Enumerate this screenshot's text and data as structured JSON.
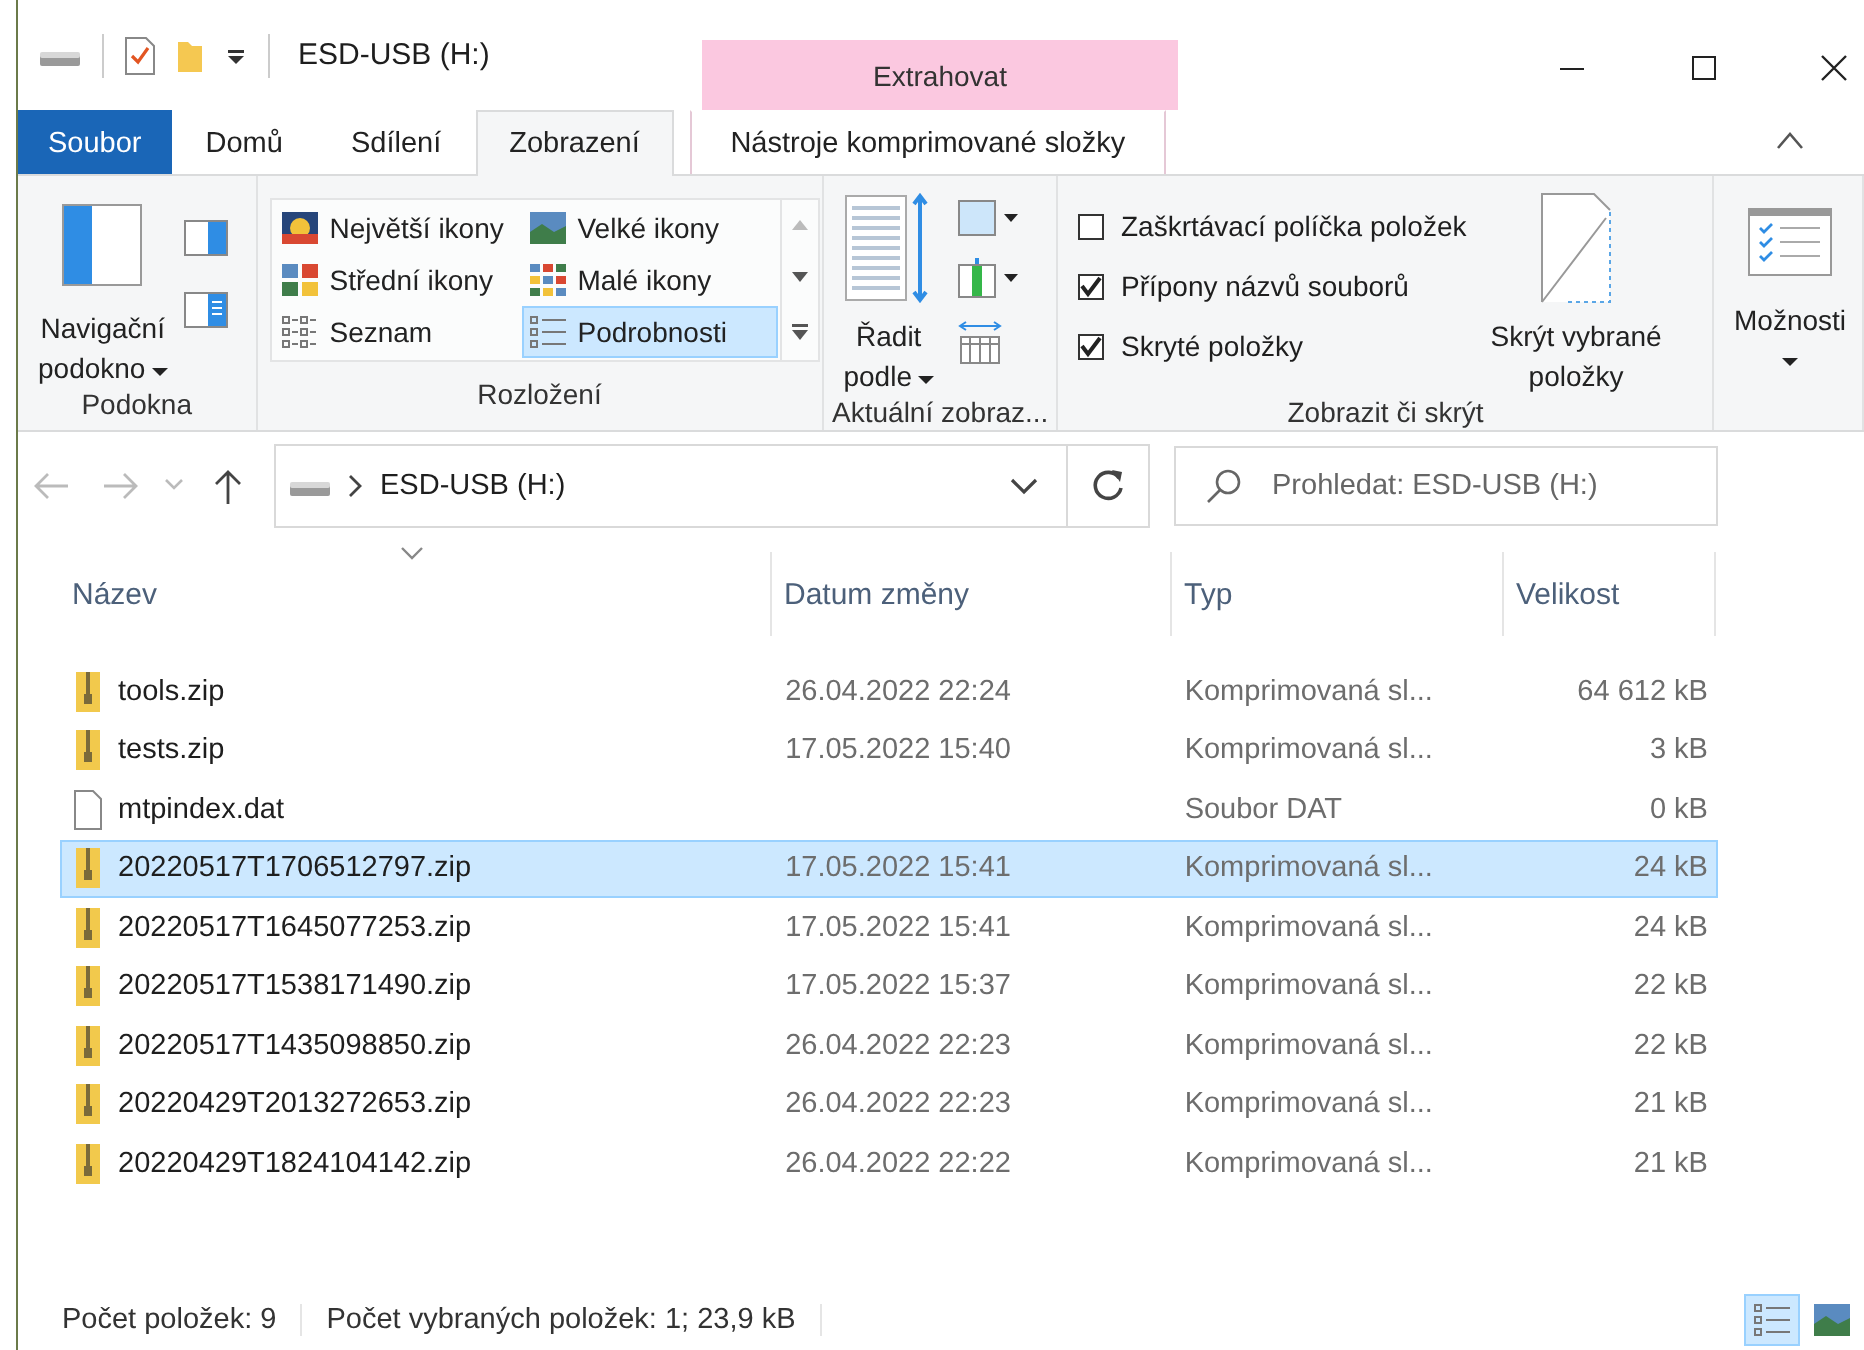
{
  "window": {
    "title": "ESD-USB (H:)",
    "context_group": "Extrahovat"
  },
  "tabs": [
    {
      "label": "Soubor",
      "kind": "file",
      "selected": false
    },
    {
      "label": "Domů",
      "kind": "normal",
      "selected": false
    },
    {
      "label": "Sdílení",
      "kind": "normal",
      "selected": false
    },
    {
      "label": "Zobrazení",
      "kind": "normal",
      "selected": true
    },
    {
      "label": "Nástroje komprimované složky",
      "kind": "context",
      "selected": false
    }
  ],
  "ribbon": {
    "panes": {
      "label": "Podokna",
      "nav_button": "Navigační\npodokno"
    },
    "layout": {
      "label": "Rozložení",
      "items": [
        {
          "label": "Největší ikony",
          "kind": "xl",
          "selected": false
        },
        {
          "label": "Velké ikony",
          "kind": "large",
          "selected": false
        },
        {
          "label": "Střední ikony",
          "kind": "medium",
          "selected": false
        },
        {
          "label": "Malé ikony",
          "kind": "small",
          "selected": false
        },
        {
          "label": "Seznam",
          "kind": "list",
          "selected": false
        },
        {
          "label": "Podrobnosti",
          "kind": "details",
          "selected": true
        }
      ]
    },
    "current_view": {
      "label": "Aktuální zobraz...",
      "sort_button": "Řadit\npodle"
    },
    "show_hide": {
      "label": "Zobrazit či skrýt",
      "checkboxes": [
        {
          "label": "Zaškrtávací políčka položek",
          "checked": false
        },
        {
          "label": "Přípony názvů souborů",
          "checked": true
        },
        {
          "label": "Skryté položky",
          "checked": true
        }
      ],
      "hide_button": "Skrýt vybrané\npoložky"
    },
    "options": {
      "button": "Možnosti"
    }
  },
  "address": {
    "path": "ESD-USB (H:)"
  },
  "search": {
    "placeholder": "Prohledat: ESD-USB (H:)"
  },
  "columns": [
    "Název",
    "Datum změny",
    "Typ",
    "Velikost"
  ],
  "rows": [
    {
      "kind": "zip",
      "name": "tools.zip",
      "date": "26.04.2022 22:24",
      "type": "Komprimovaná sl...",
      "size": "64 612 kB",
      "selected": false
    },
    {
      "kind": "zip",
      "name": "tests.zip",
      "date": "17.05.2022 15:40",
      "type": "Komprimovaná sl...",
      "size": "3 kB",
      "selected": false
    },
    {
      "kind": "file",
      "name": "mtpindex.dat",
      "type": "Soubor DAT",
      "size": "0 kB",
      "selected": false
    },
    {
      "kind": "zip",
      "name": "20220517T1706512797.zip",
      "date": "17.05.2022 15:41",
      "type": "Komprimovaná sl...",
      "size": "24 kB",
      "selected": true
    },
    {
      "kind": "zip",
      "name": "20220517T1645077253.zip",
      "date": "17.05.2022 15:41",
      "type": "Komprimovaná sl...",
      "size": "24 kB",
      "selected": false
    },
    {
      "kind": "zip",
      "name": "20220517T1538171490.zip",
      "date": "17.05.2022 15:37",
      "type": "Komprimovaná sl...",
      "size": "22 kB",
      "selected": false
    },
    {
      "kind": "zip",
      "name": "20220517T1435098850.zip",
      "date": "26.04.2022 22:23",
      "type": "Komprimovaná sl...",
      "size": "22 kB",
      "selected": false
    },
    {
      "kind": "zip",
      "name": "20220429T2013272653.zip",
      "date": "26.04.2022 22:23",
      "type": "Komprimovaná sl...",
      "size": "21 kB",
      "selected": false
    },
    {
      "kind": "zip",
      "name": "20220429T1824104142.zip",
      "date": "26.04.2022 22:22",
      "type": "Komprimovaná sl...",
      "size": "21 kB",
      "selected": false
    }
  ],
  "status_bar": {
    "items": [
      "Počet položek: 9",
      "Počet vybraných položek: 1; 23,9 kB"
    ],
    "view_buttons": [
      {
        "kind": "details",
        "selected": true
      },
      {
        "kind": "large",
        "selected": false
      }
    ]
  }
}
